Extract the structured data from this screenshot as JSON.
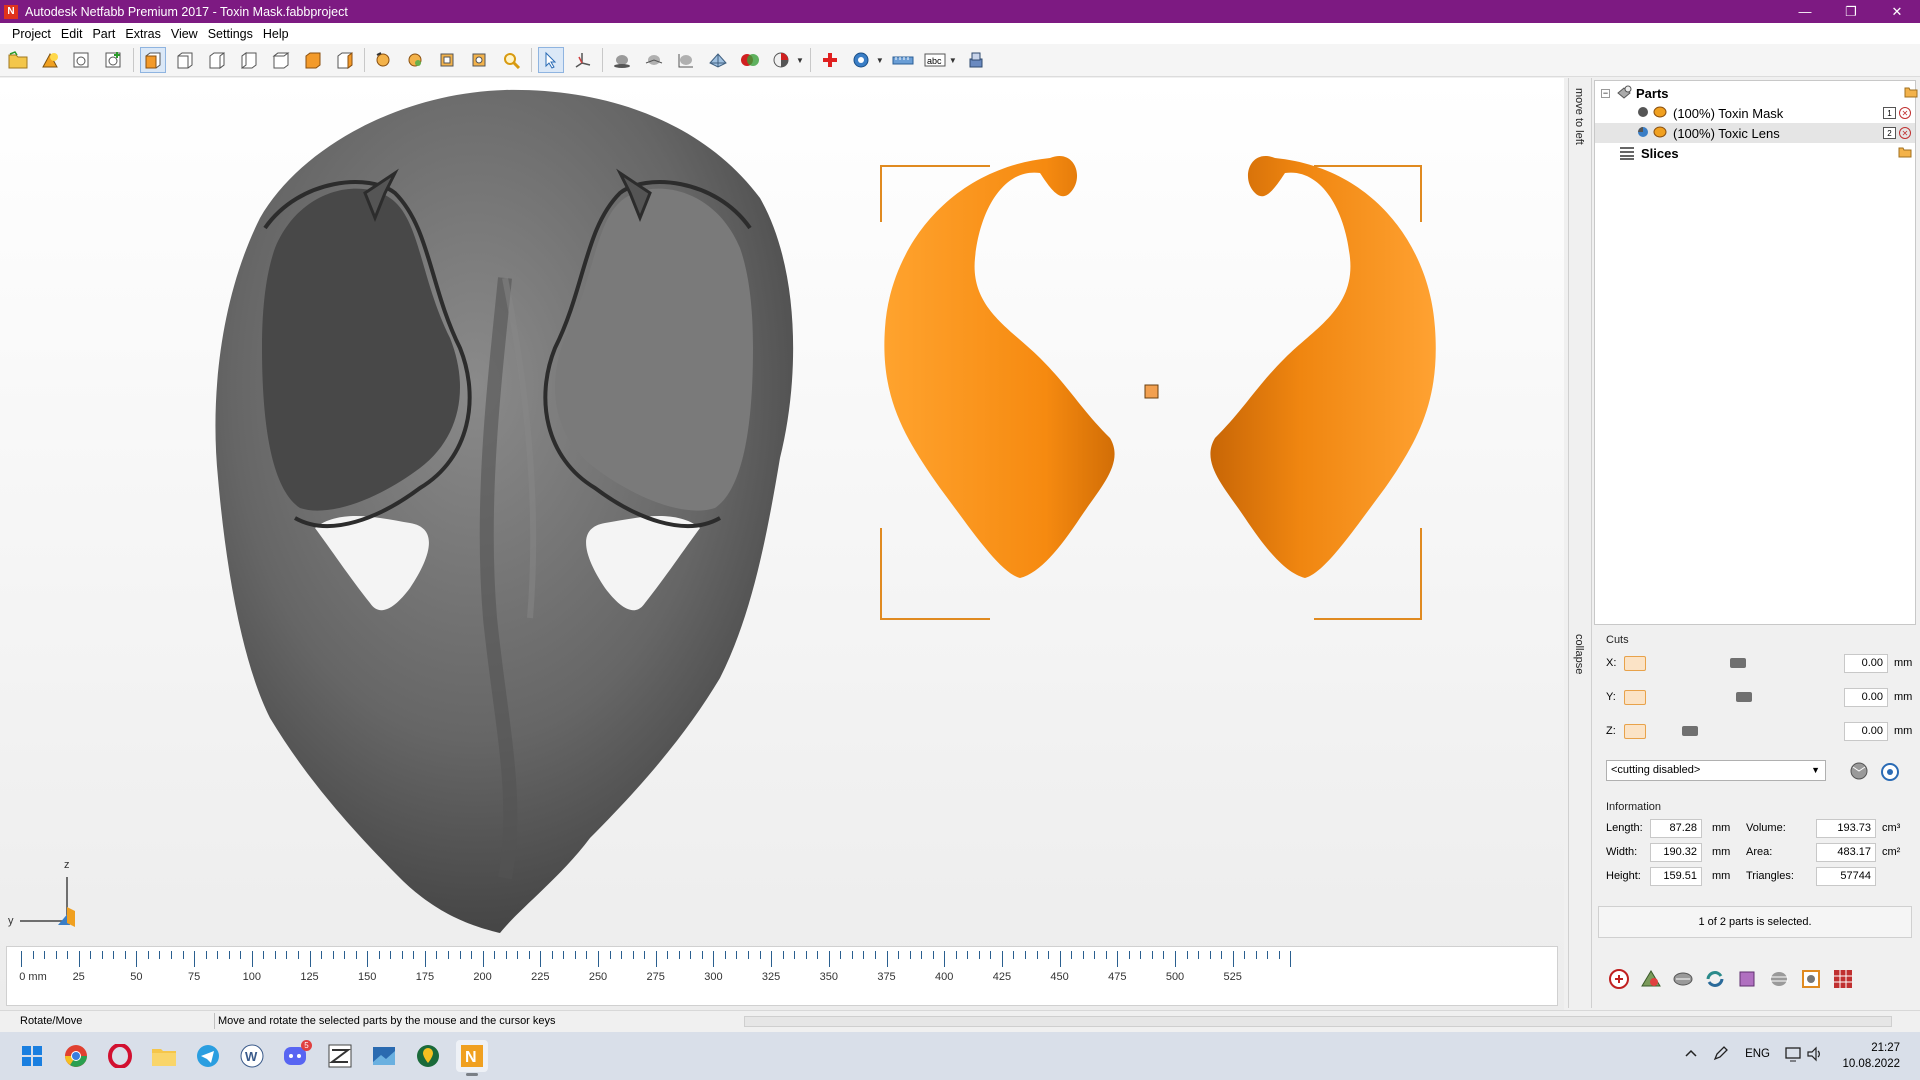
{
  "window": {
    "title": "Autodesk Netfabb Premium 2017 - Toxin Mask.fabbproject",
    "logo_letter": "N",
    "controls": [
      "—",
      "❐",
      "✕"
    ]
  },
  "menu": [
    "Project",
    "Edit",
    "Part",
    "Extras",
    "View",
    "Settings",
    "Help"
  ],
  "toolbar": {
    "groups": [
      [
        "open-icon",
        "add-part-icon",
        "part-info-icon",
        "part-add-icon"
      ],
      [
        "view-front-icon",
        "view-back-icon",
        "view-left-icon",
        "view-right-icon",
        "view-top-icon",
        "view-bottom-icon",
        "view-iso-icon"
      ],
      [
        "orbit-icon",
        "pan-icon",
        "zoom-all-icon",
        "zoom-selection-icon",
        "zoom-icon"
      ],
      [
        "select-icon",
        "move-axis-icon"
      ],
      [
        "shade-icon",
        "shade-smooth-icon",
        "measure-part-icon",
        "mesh-icon",
        "boolean-icon",
        "pie-icon"
      ],
      [
        "repair-icon",
        "settings-sphere-icon",
        "ruler-icon",
        "label-icon",
        "printer-icon"
      ]
    ],
    "dropdown_after": [
      "pie-icon",
      "settings-sphere-icon",
      "label-icon"
    ],
    "active": "select-icon"
  },
  "viewport": {
    "ruler_labels": [
      "0 mm",
      "25",
      "50",
      "75",
      "100",
      "125",
      "150",
      "175",
      "200",
      "225",
      "250",
      "275",
      "300",
      "325",
      "350",
      "375",
      "400",
      "425",
      "450",
      "475",
      "500",
      "525"
    ],
    "axis_labels": {
      "z": "z",
      "y": "y"
    },
    "colors": {
      "mask": "#606060",
      "lens": "#f28a12",
      "selection": "#e08a20"
    }
  },
  "side_tabs": {
    "top": "move to left",
    "bottom": "collapse"
  },
  "tree": {
    "root": "Parts",
    "parts": [
      {
        "label": "(100%) Toxin Mask",
        "badge": "1",
        "selected": false
      },
      {
        "label": "(100%) Toxic Lens",
        "badge": "2",
        "selected": true
      }
    ],
    "slices": "Slices"
  },
  "cuts": {
    "title": "Cuts",
    "rows": [
      {
        "axis": "X:",
        "value": "0.00",
        "unit": "mm"
      },
      {
        "axis": "Y:",
        "value": "0.00",
        "unit": "mm"
      },
      {
        "axis": "Z:",
        "value": "0.00",
        "unit": "mm"
      }
    ],
    "mode": "<cutting disabled>"
  },
  "information": {
    "title": "Information",
    "length": {
      "label": "Length:",
      "value": "87.28",
      "unit": "mm"
    },
    "width": {
      "label": "Width:",
      "value": "190.32",
      "unit": "mm"
    },
    "height": {
      "label": "Height:",
      "value": "159.51",
      "unit": "mm"
    },
    "volume": {
      "label": "Volume:",
      "value": "193.73",
      "unit": "cm³"
    },
    "area": {
      "label": "Area:",
      "value": "483.17",
      "unit": "cm²"
    },
    "triangles": {
      "label": "Triangles:",
      "value": "57744"
    },
    "selection_msg": "1 of 2 parts is selected."
  },
  "status": {
    "mode": "Rotate/Move",
    "hint": "Move and rotate the selected parts by the mouse and the cursor keys"
  },
  "taskbar": {
    "apps": [
      "windows-start-icon",
      "chrome-icon",
      "opera-icon",
      "file-explorer-icon",
      "telegram-icon",
      "w-app-icon",
      "discord-icon",
      "zbrush-icon",
      "image-viewer-icon",
      "maps-icon",
      "netfabb-icon"
    ],
    "discord_badge": "5",
    "lang": "ENG",
    "time": "21:27",
    "date": "10.08.2022"
  }
}
